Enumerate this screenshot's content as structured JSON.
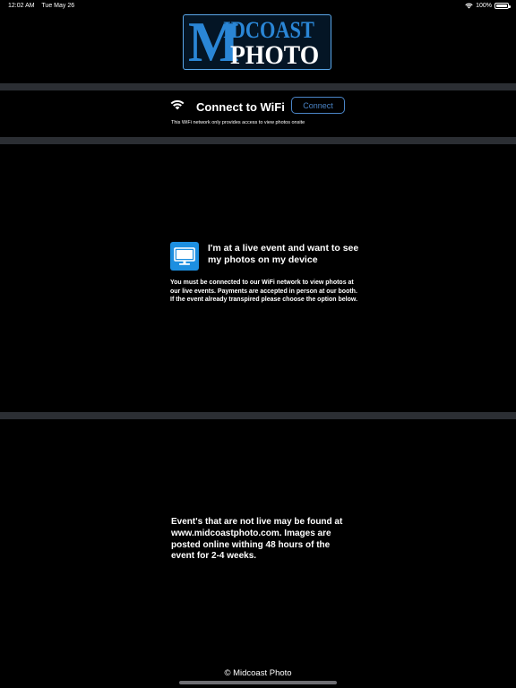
{
  "status_bar": {
    "time": "12:02 AM",
    "date": "Tue May 26",
    "battery_percent": "100%",
    "battery_level": 1.0
  },
  "logo": {
    "line1": "MIDCOAST",
    "line1_big_letter": "M",
    "line1_rest": "IDCOAST",
    "line2": "PHOTO",
    "colors": {
      "blue": "#2a86d6",
      "white": "#ffffff",
      "border": "#5aa7ea"
    }
  },
  "wifi": {
    "icon": "wifi-icon",
    "title": "Connect to WiFi",
    "button_label": "Connect",
    "note": "This WiFi network only provides access to view photos onsite"
  },
  "live_event": {
    "icon": "monitor-icon",
    "title": "I'm at a live event and want to see my photos on my device",
    "description": "You must be connected to our WiFi network to view photos at our live events. Payments are accepted in person at our booth. If the event already transpired please choose the option below."
  },
  "not_live": {
    "text": "Event's that are not live may be found at www.midcoastphoto.com. Images are posted online withing 48 hours of the event for 2-4 weeks."
  },
  "footer": {
    "copyright": "© Midcoast Photo"
  },
  "colors": {
    "background": "#000000",
    "divider": "#2b2e33",
    "accent": "#4a84c6",
    "icon_blue": "#1d8fe0"
  }
}
